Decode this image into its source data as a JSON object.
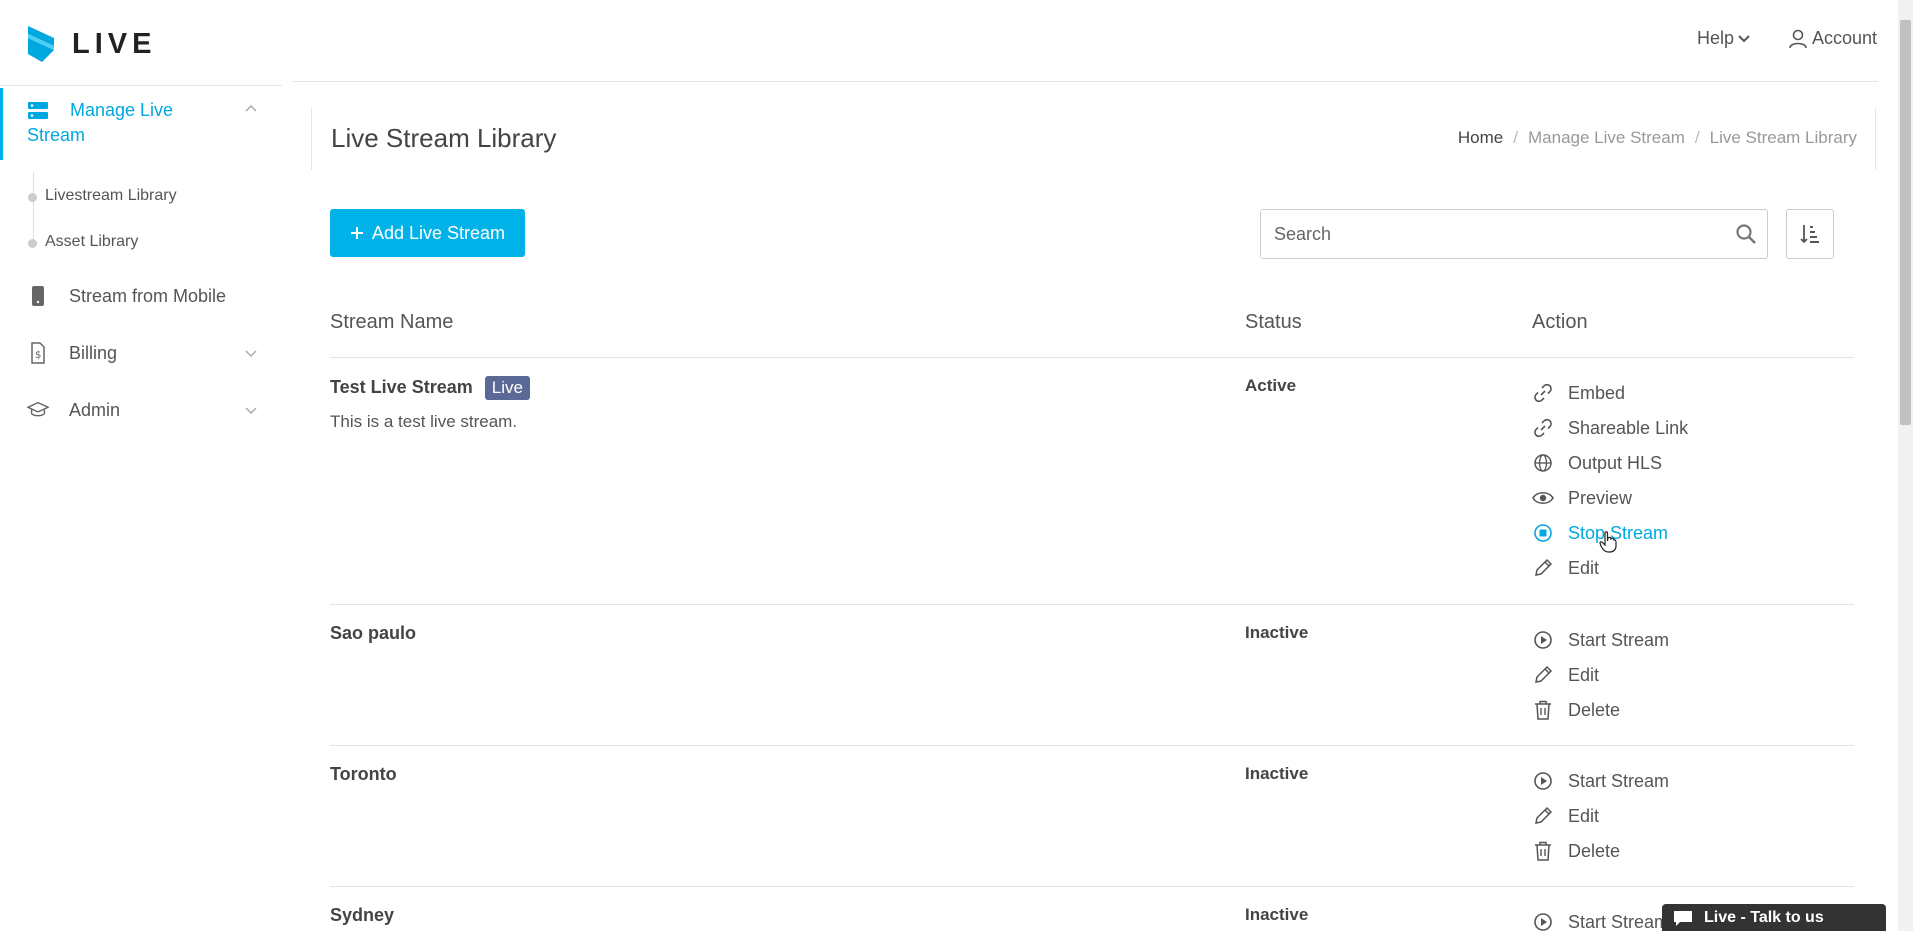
{
  "app": {
    "logo_text": "LIVE",
    "accent": "#00b2e8"
  },
  "sidebar": {
    "manage_label": "Manage Live Stream",
    "sub_items": [
      "Livestream Library",
      "Asset Library"
    ],
    "mobile_label": "Stream from Mobile",
    "billing_label": "Billing",
    "admin_label": "Admin"
  },
  "header": {
    "help": "Help",
    "account": "Account"
  },
  "page": {
    "title": "Live Stream Library",
    "breadcrumb": [
      "Home",
      "Manage Live Stream",
      "Live Stream Library"
    ]
  },
  "toolbar": {
    "add_label": "Add Live Stream",
    "search_placeholder": "Search"
  },
  "table": {
    "headers": [
      "Stream Name",
      "Status",
      "Action"
    ],
    "rows": [
      {
        "name": "Test Live Stream",
        "badge": "Live",
        "desc": "This is a test live stream.",
        "status": "Active",
        "actions": [
          "Embed",
          "Shareable Link",
          "Output HLS",
          "Preview",
          "Stop Stream",
          "Edit"
        ]
      },
      {
        "name": "Sao paulo",
        "status": "Inactive",
        "actions": [
          "Start Stream",
          "Edit",
          "Delete"
        ]
      },
      {
        "name": "Toronto",
        "status": "Inactive",
        "actions": [
          "Start Stream",
          "Edit",
          "Delete"
        ]
      },
      {
        "name": "Sydney",
        "status": "Inactive",
        "actions": [
          "Start Stream"
        ]
      }
    ]
  },
  "chat": {
    "label": "Live - Talk to us"
  }
}
